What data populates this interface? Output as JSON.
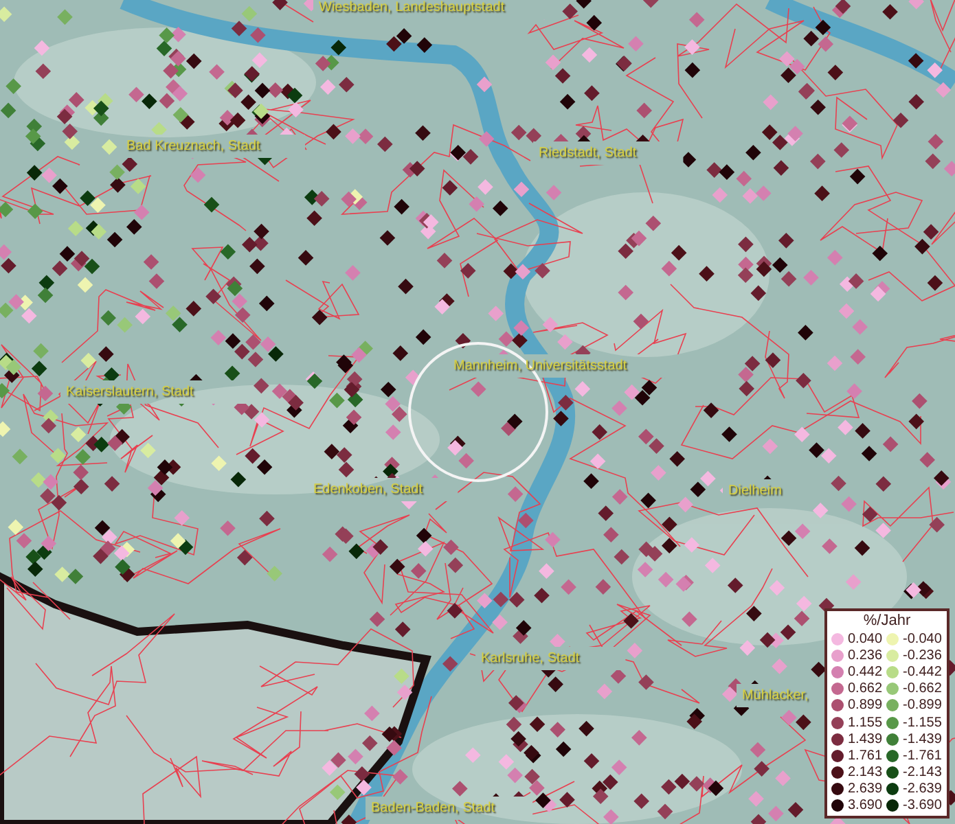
{
  "map": {
    "labels": [
      {
        "text": "Wiesbaden, Landeshauptstadt"
      },
      {
        "text": "Bad Kreuznach, Stadt"
      },
      {
        "text": "Riedstadt, Stadt"
      },
      {
        "text": "Kaiserslautern, Stadt"
      },
      {
        "text": "Mannheim, Universitätsstadt"
      },
      {
        "text": "Edenkoben, Stadt"
      },
      {
        "text": "Dielheim"
      },
      {
        "text": "Karlsruhe, Stadt"
      },
      {
        "text": "Mühlacker,"
      },
      {
        "text": "Baden-Baden, Stadt"
      }
    ]
  },
  "legend": {
    "title": "%/Jahr",
    "positive": [
      {
        "label": "0.040",
        "color": "#f4b8e0"
      },
      {
        "label": "0.236",
        "color": "#e8a0cc"
      },
      {
        "label": "0.442",
        "color": "#d480b0"
      },
      {
        "label": "0.662",
        "color": "#c46890"
      },
      {
        "label": "0.899",
        "color": "#ac5070"
      },
      {
        "label": "1.155",
        "color": "#944058"
      },
      {
        "label": "1.439",
        "color": "#7c2c40"
      },
      {
        "label": "1.761",
        "color": "#641c2c"
      },
      {
        "label": "2.143",
        "color": "#4c1018"
      },
      {
        "label": "2.639",
        "color": "#360a10"
      },
      {
        "label": "3.690",
        "color": "#200408"
      }
    ],
    "negative": [
      {
        "label": "-0.040",
        "color": "#eef4b0"
      },
      {
        "label": "-0.236",
        "color": "#d8eca0"
      },
      {
        "label": "-0.442",
        "color": "#b8dc88"
      },
      {
        "label": "-0.662",
        "color": "#98c878"
      },
      {
        "label": "-0.899",
        "color": "#78b060"
      },
      {
        "label": "-1.155",
        "color": "#589848"
      },
      {
        "label": "-1.439",
        "color": "#408038"
      },
      {
        "label": "-1.761",
        "color": "#286828"
      },
      {
        "label": "-2.143",
        "color": "#185018"
      },
      {
        "label": "-2.639",
        "color": "#0c3c10"
      },
      {
        "label": "-3.690",
        "color": "#082808"
      }
    ]
  }
}
